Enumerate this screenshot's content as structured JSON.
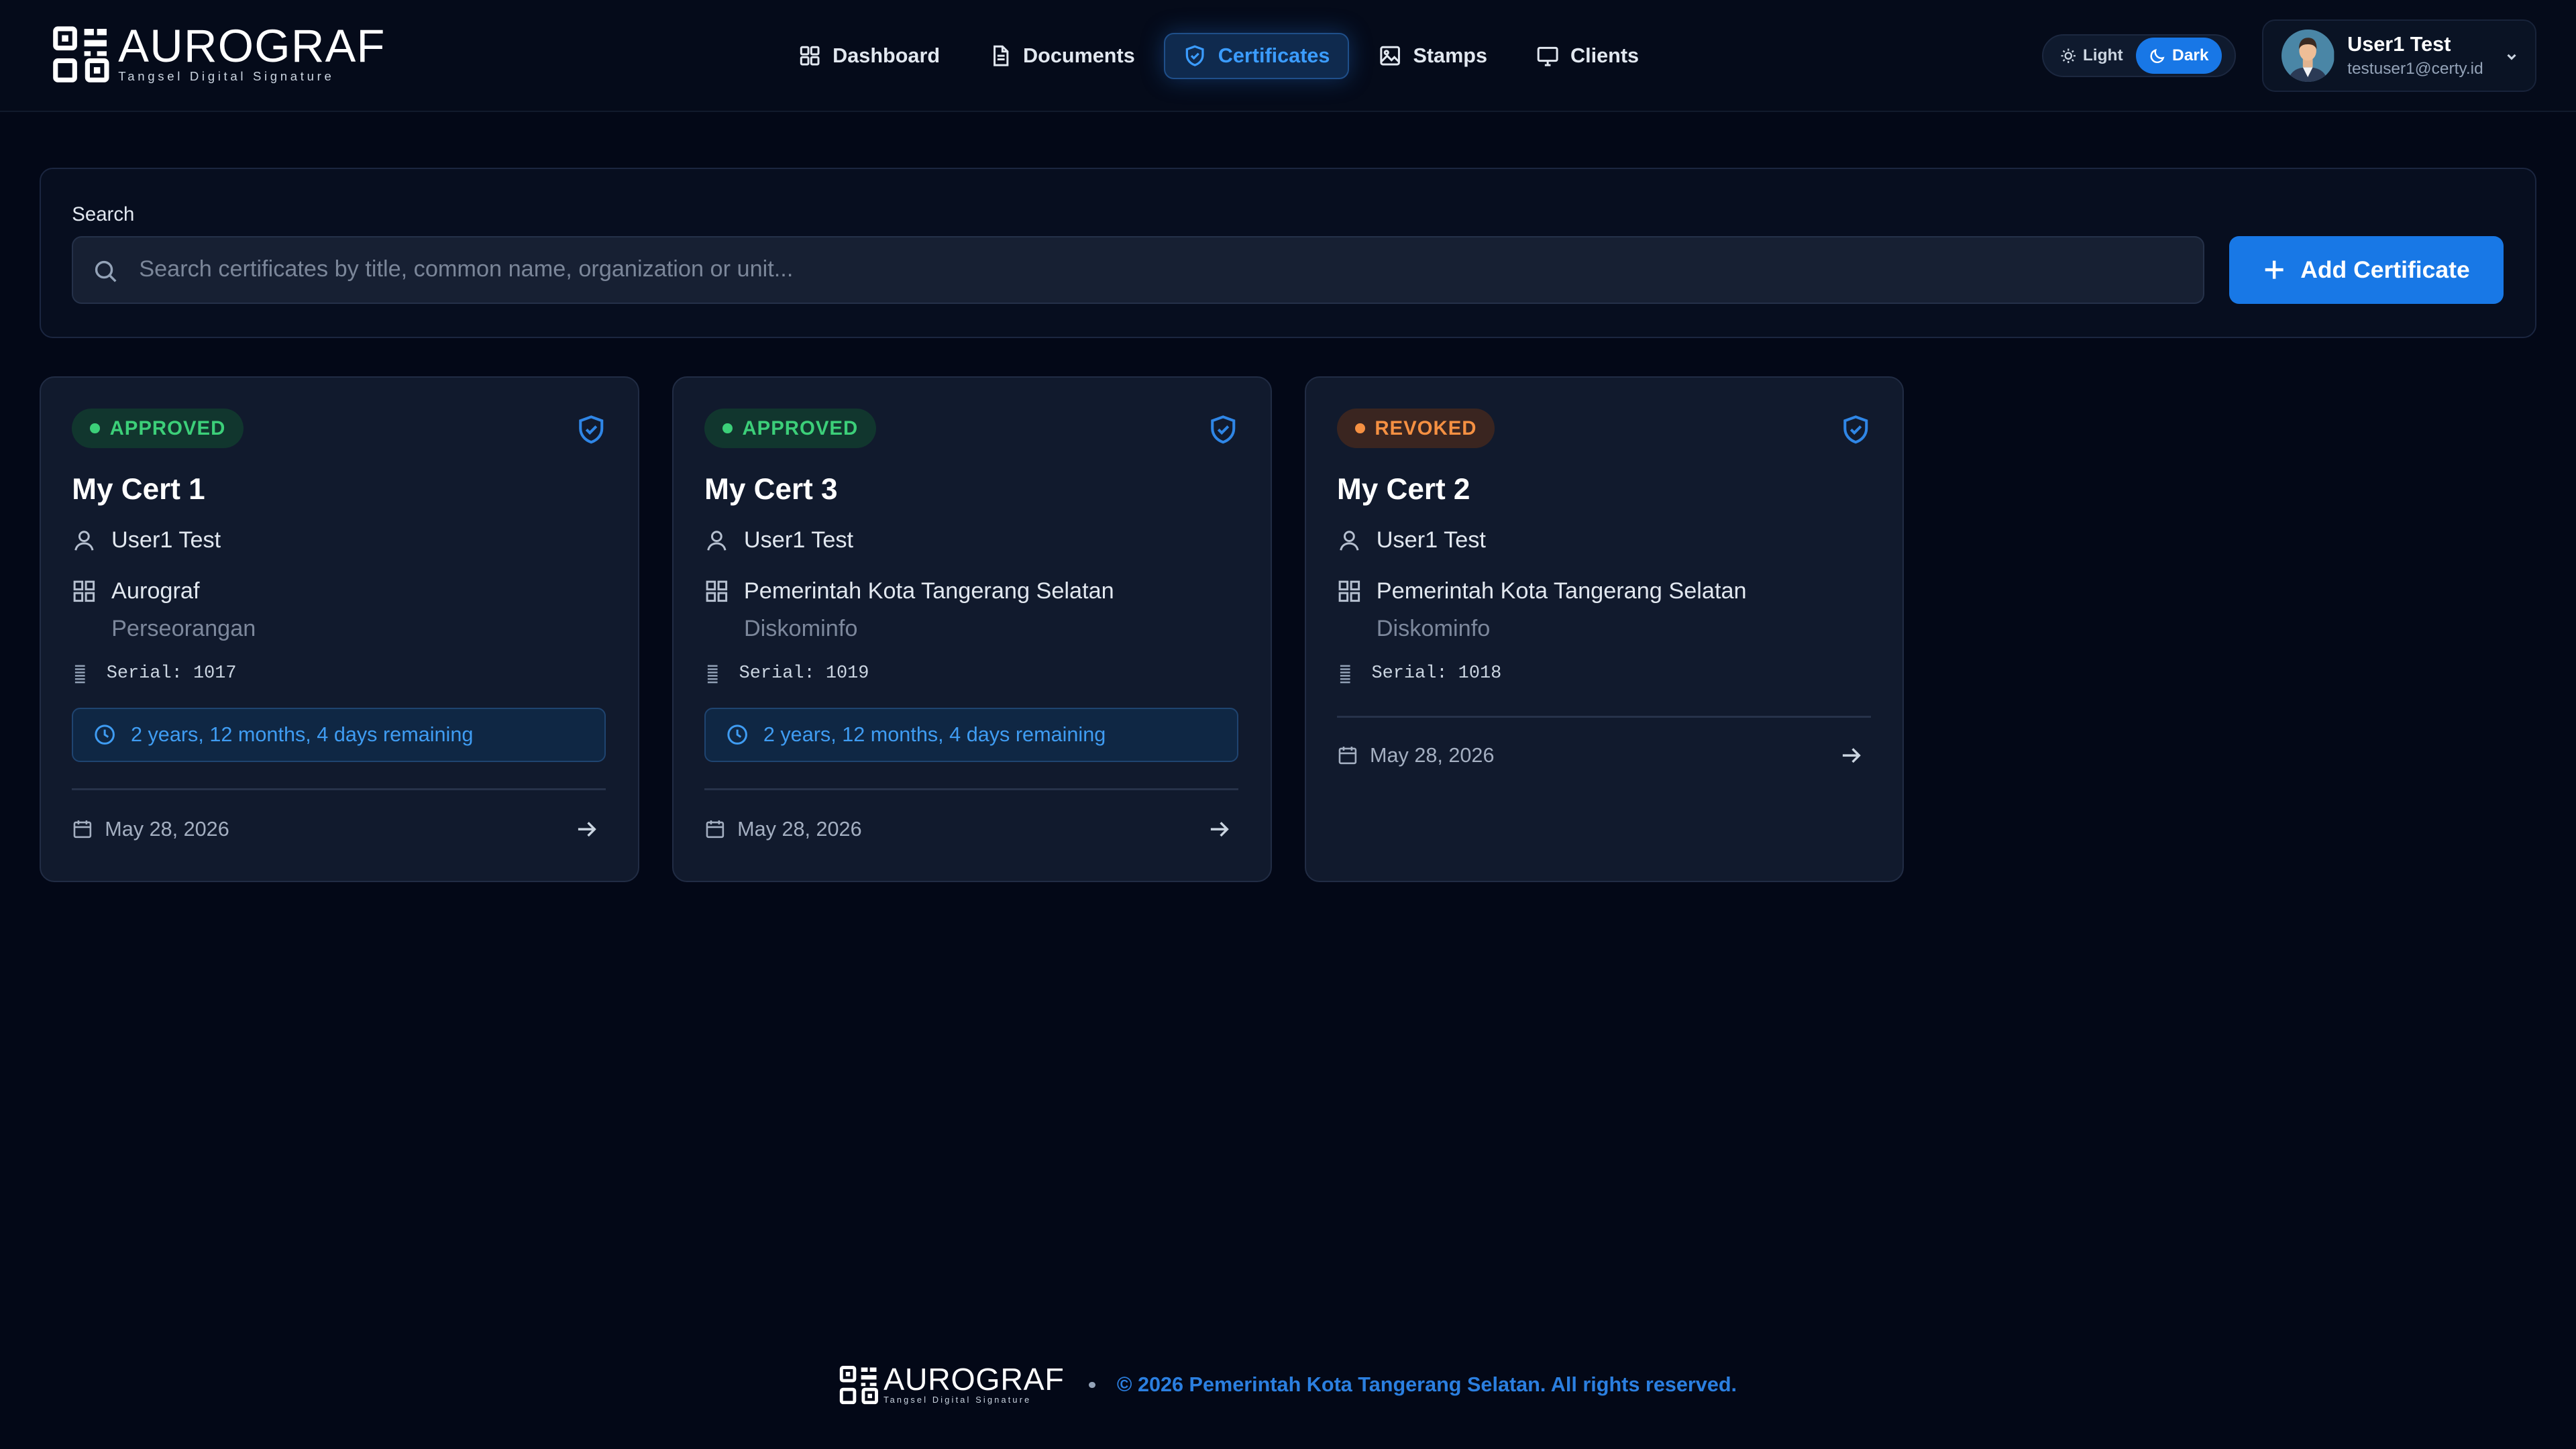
{
  "brand": {
    "name": "AUROGRAF",
    "tagline": "Tangsel Digital Signature"
  },
  "nav": [
    {
      "label": "Dashboard",
      "icon": "grid-icon"
    },
    {
      "label": "Documents",
      "icon": "document-icon"
    },
    {
      "label": "Certificates",
      "icon": "shield-check-icon",
      "active": true
    },
    {
      "label": "Stamps",
      "icon": "image-icon"
    },
    {
      "label": "Clients",
      "icon": "monitor-icon"
    }
  ],
  "theme": {
    "light_label": "Light",
    "dark_label": "Dark",
    "selected": "Dark"
  },
  "user": {
    "name": "User1 Test",
    "email": "testuser1@certy.id"
  },
  "search": {
    "label": "Search",
    "placeholder": "Search certificates by title, common name, organization or unit...",
    "value": ""
  },
  "add_button": {
    "label": "Add Certificate"
  },
  "certificates": [
    {
      "status": "APPROVED",
      "title": "My Cert 1",
      "common_name": "User1 Test",
      "organization": "Aurograf",
      "unit": "Perseorangan",
      "serial": "Serial: 1017",
      "remaining": "2 years, 12 months, 4 days remaining",
      "date": "May 28, 2026"
    },
    {
      "status": "APPROVED",
      "title": "My Cert 3",
      "common_name": "User1 Test",
      "organization": "Pemerintah Kota Tangerang Selatan",
      "unit": "Diskominfo",
      "serial": "Serial: 1019",
      "remaining": "2 years, 12 months, 4 days remaining",
      "date": "May 28, 2026"
    },
    {
      "status": "REVOKED",
      "title": "My Cert 2",
      "common_name": "User1 Test",
      "organization": "Pemerintah Kota Tangerang Selatan",
      "unit": "Diskominfo",
      "serial": "Serial: 1018",
      "remaining": "",
      "date": "May 28, 2026"
    }
  ],
  "footer": {
    "copyright": "© 2026 Pemerintah Kota Tangerang Selatan. All rights reserved."
  },
  "colors": {
    "accent": "#1878e6",
    "approved": "#3ccf79",
    "revoked": "#f59042",
    "background": "#030817"
  }
}
